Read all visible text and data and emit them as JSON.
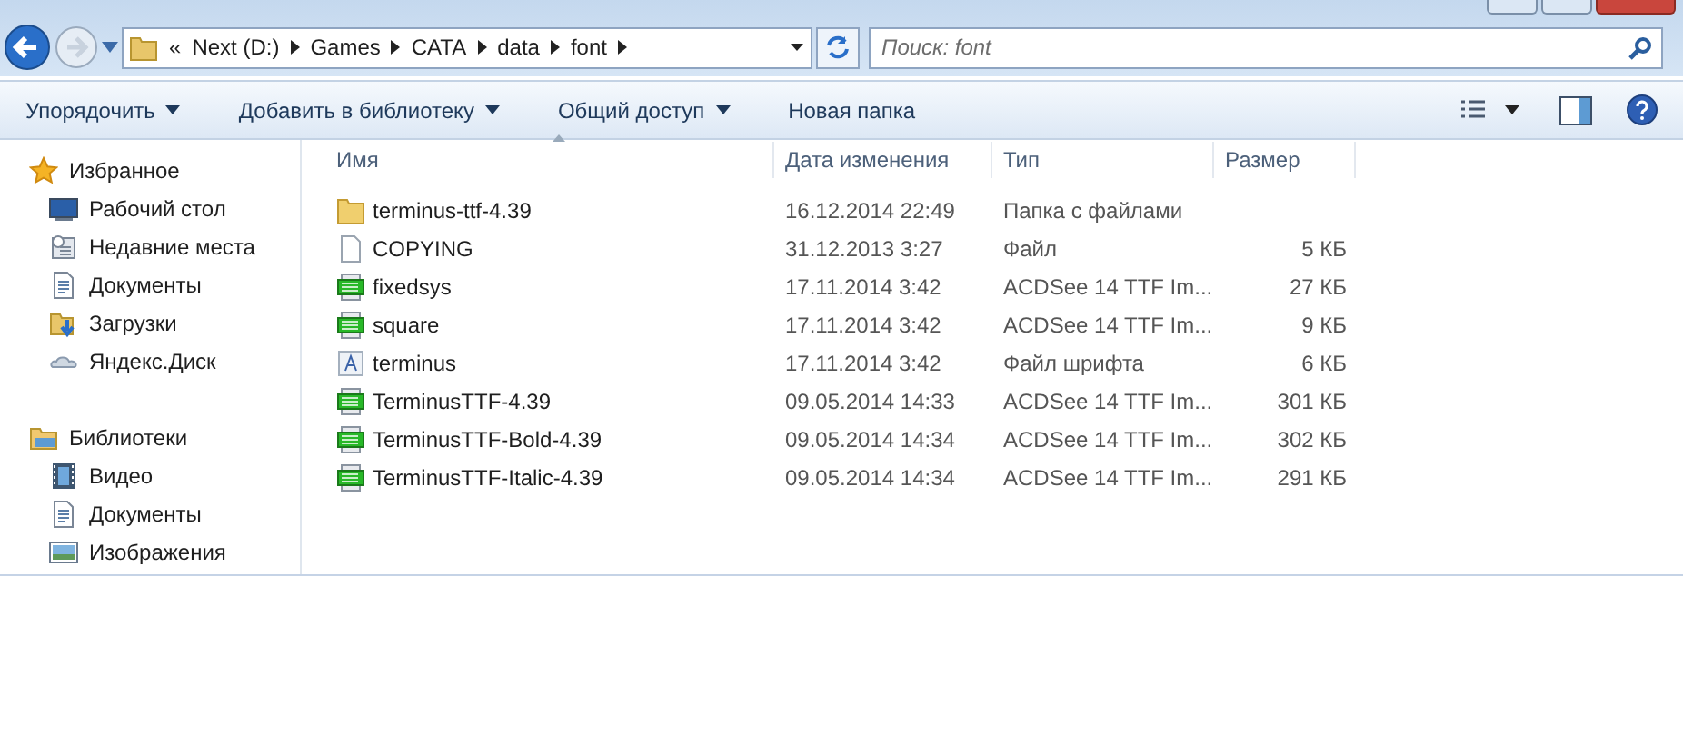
{
  "address_bar": {
    "crumbs": [
      "«",
      "Next (D:)",
      "Games",
      "CATA",
      "data",
      "font"
    ]
  },
  "search": {
    "placeholder": "Поиск: font"
  },
  "toolbar": {
    "items": [
      {
        "label": "Упорядочить",
        "dropdown": true
      },
      {
        "label": "Добавить в библиотеку",
        "dropdown": true
      },
      {
        "label": "Общий доступ",
        "dropdown": true
      },
      {
        "label": "Новая папка",
        "dropdown": false
      }
    ]
  },
  "sidebar": {
    "groups": [
      {
        "label": "Избранное",
        "kind": "star",
        "children": [
          {
            "label": "Рабочий стол",
            "kind": "desktop"
          },
          {
            "label": "Недавние места",
            "kind": "recent"
          },
          {
            "label": "Документы",
            "kind": "document"
          },
          {
            "label": "Загрузки",
            "kind": "download"
          },
          {
            "label": "Яндекс.Диск",
            "kind": "cloud"
          }
        ]
      },
      {
        "label": "Библиотеки",
        "kind": "library",
        "children": [
          {
            "label": "Видео",
            "kind": "video"
          },
          {
            "label": "Документы",
            "kind": "document"
          },
          {
            "label": "Изображения",
            "kind": "image"
          }
        ]
      }
    ]
  },
  "table": {
    "columns": [
      "Имя",
      "Дата изменения",
      "Тип",
      "Размер"
    ],
    "rows": [
      {
        "kind": "folder",
        "name": "terminus-ttf-4.39",
        "date": "16.12.2014 22:49",
        "type": "Папка с файлами",
        "size": ""
      },
      {
        "kind": "file",
        "name": "COPYING",
        "date": "31.12.2013 3:27",
        "type": "Файл",
        "size": "5 КБ"
      },
      {
        "kind": "ttf",
        "name": "fixedsys",
        "date": "17.11.2014 3:42",
        "type": "ACDSee 14 TTF Im...",
        "size": "27 КБ"
      },
      {
        "kind": "ttf",
        "name": "square",
        "date": "17.11.2014 3:42",
        "type": "ACDSee 14 TTF Im...",
        "size": "9 КБ"
      },
      {
        "kind": "font",
        "name": "terminus",
        "date": "17.11.2014 3:42",
        "type": "Файл шрифта",
        "size": "6 КБ"
      },
      {
        "kind": "ttf",
        "name": "TerminusTTF-4.39",
        "date": "09.05.2014 14:33",
        "type": "ACDSee 14 TTF Im...",
        "size": "301 КБ"
      },
      {
        "kind": "ttf",
        "name": "TerminusTTF-Bold-4.39",
        "date": "09.05.2014 14:34",
        "type": "ACDSee 14 TTF Im...",
        "size": "302 КБ"
      },
      {
        "kind": "ttf",
        "name": "TerminusTTF-Italic-4.39",
        "date": "09.05.2014 14:34",
        "type": "ACDSee 14 TTF Im...",
        "size": "291 КБ"
      }
    ]
  }
}
